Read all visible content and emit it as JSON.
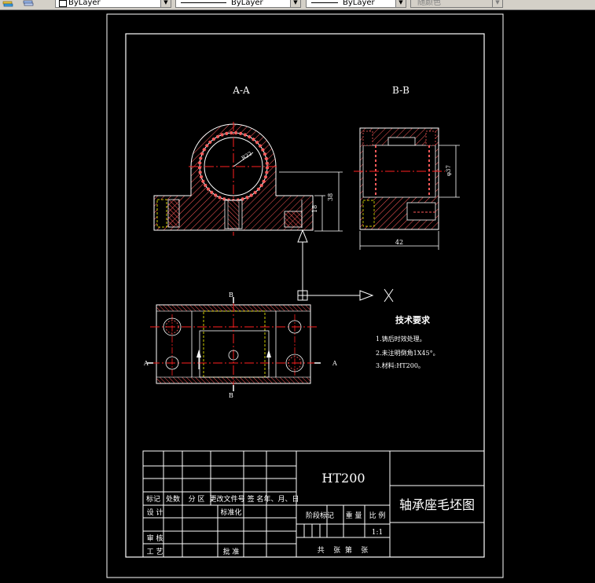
{
  "toolbar": {
    "layer_combo": "ByLayer",
    "linetype_combo": "ByLayer",
    "lineweight_combo": "ByLayer",
    "color_combo": "随颜色"
  },
  "drawing": {
    "section_a_label": "A-A",
    "section_b_label": "B-B",
    "dim_r22": "R22",
    "dim_38": "38",
    "dim_18": "18",
    "dim_42": "42",
    "dim_d37": "φ37",
    "cut_b": "B",
    "cut_a": "A",
    "tech_title": "技术要求",
    "tech_items": [
      "1.铸后时效处理。",
      "2.未注明倒角1X45°。",
      "3.材料:HT200。"
    ]
  },
  "title_block": {
    "material": "HT200",
    "part_name": "轴承座毛坯图",
    "hdr_mark": "标记",
    "hdr_count": "处数",
    "hdr_zone": "分 区",
    "hdr_change_doc": "更改文件号",
    "hdr_sign": "签 名",
    "hdr_date": "年、月、日",
    "row_design": "设 计",
    "row_standard": "标准化",
    "row_review": "审 核",
    "row_process": "工 艺",
    "row_approve": "批 准",
    "stage_mark": "阶段标记",
    "weight": "重 量",
    "scale_label": "比 例",
    "scale_value": "1:1",
    "sheets": "共    张  第    张"
  },
  "colors": {
    "background": "#000000",
    "lines": "#ffffff",
    "centerline": "#ff0000",
    "hidden": "#ffff00",
    "hatch": "#ff5a5a"
  }
}
